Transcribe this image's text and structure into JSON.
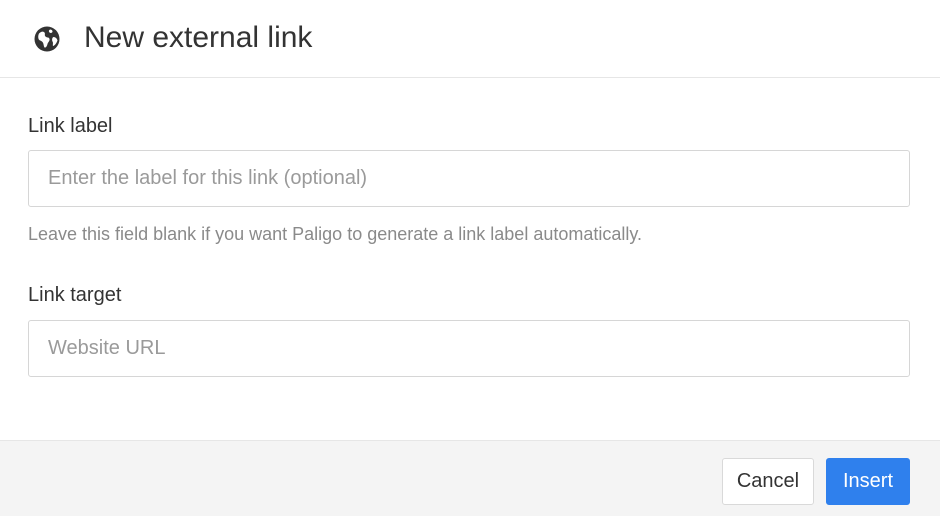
{
  "dialog": {
    "title": "New external link",
    "title_icon": "globe-icon"
  },
  "fields": {
    "link_label": {
      "label": "Link label",
      "value": "",
      "placeholder": "Enter the label for this link (optional)",
      "help": "Leave this field blank if you want Paligo to generate a link label automatically."
    },
    "link_target": {
      "label": "Link target",
      "value": "",
      "placeholder": "Website URL"
    }
  },
  "footer": {
    "cancel_label": "Cancel",
    "insert_label": "Insert"
  },
  "colors": {
    "primary": "#2f80ed",
    "footer_bg": "#f4f4f4",
    "text": "#333333",
    "muted": "#8a8a8a"
  }
}
